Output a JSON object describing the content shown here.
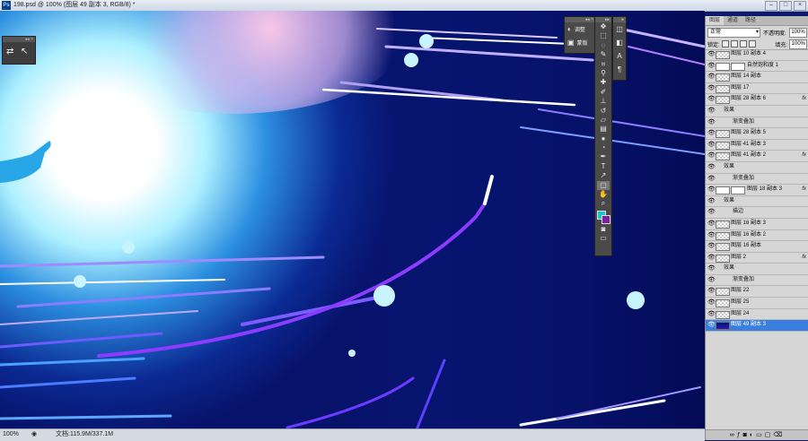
{
  "window": {
    "title": "198.psd @ 100% (图层 49 副本 3, RGB/8) *",
    "controls": [
      "–",
      "□",
      "×"
    ]
  },
  "statusbar": {
    "zoom": "100%",
    "doc": "文档:115.9M/337.1M"
  },
  "adjust_panel": {
    "items": [
      "调整",
      "蒙版"
    ]
  },
  "layers_panel": {
    "tabs": [
      "图层",
      "通道",
      "路径"
    ],
    "blend_mode": "正常",
    "opacity_label": "不透明度:",
    "opacity": "100%",
    "lock_label": "锁定:",
    "fill_label": "填充:",
    "fill": "100%",
    "rows": [
      {
        "name": "图层 10 副本 4",
        "kind": "layer"
      },
      {
        "name": "自然饱和度 1",
        "kind": "adjustment"
      },
      {
        "name": "图层 14 副本",
        "kind": "layer"
      },
      {
        "name": "图层 17",
        "kind": "layer"
      },
      {
        "name": "图层 28 副本 6",
        "kind": "layer",
        "fx": "fx"
      },
      {
        "name": "效果",
        "kind": "effects"
      },
      {
        "name": "渐变叠加",
        "kind": "effect"
      },
      {
        "name": "图层 28 副本 5",
        "kind": "layer"
      },
      {
        "name": "图层 41 副本 3",
        "kind": "layer"
      },
      {
        "name": "图层 41 副本 2",
        "kind": "layer",
        "fx": "fx"
      },
      {
        "name": "效果",
        "kind": "effects"
      },
      {
        "name": "渐变叠加",
        "kind": "effect"
      },
      {
        "name": "图层 18 副本 3",
        "kind": "masked",
        "fx": "fx"
      },
      {
        "name": "效果",
        "kind": "effects"
      },
      {
        "name": "描边",
        "kind": "effect"
      },
      {
        "name": "图层 16 副本 3",
        "kind": "layer"
      },
      {
        "name": "图层 16 副本 2",
        "kind": "layer"
      },
      {
        "name": "图层 16 副本",
        "kind": "layer"
      },
      {
        "name": "图层 2",
        "kind": "layer",
        "fx": "fx"
      },
      {
        "name": "效果",
        "kind": "effects"
      },
      {
        "name": "渐变叠加",
        "kind": "effect"
      },
      {
        "name": "图层 22",
        "kind": "layer"
      },
      {
        "name": "图层 25",
        "kind": "layer"
      },
      {
        "name": "图层 24",
        "kind": "layer"
      },
      {
        "name": "图层 49 副本 3",
        "kind": "selected"
      }
    ]
  },
  "colors": {
    "foreground": "#1ac6d3",
    "background": "#7b1fa2",
    "canvas_bg": "#0a1a6e"
  },
  "tools": [
    "move-icon",
    "marquee-icon",
    "lasso-icon",
    "quick-select-icon",
    "crop-icon",
    "eyedropper-icon",
    "healing-icon",
    "brush-icon",
    "stamp-icon",
    "history-brush-icon",
    "eraser-icon",
    "gradient-icon",
    "blur-icon",
    "dodge-icon",
    "pen-icon",
    "type-icon",
    "path-select-icon",
    "shape-icon",
    "hand-icon",
    "zoom-icon"
  ]
}
